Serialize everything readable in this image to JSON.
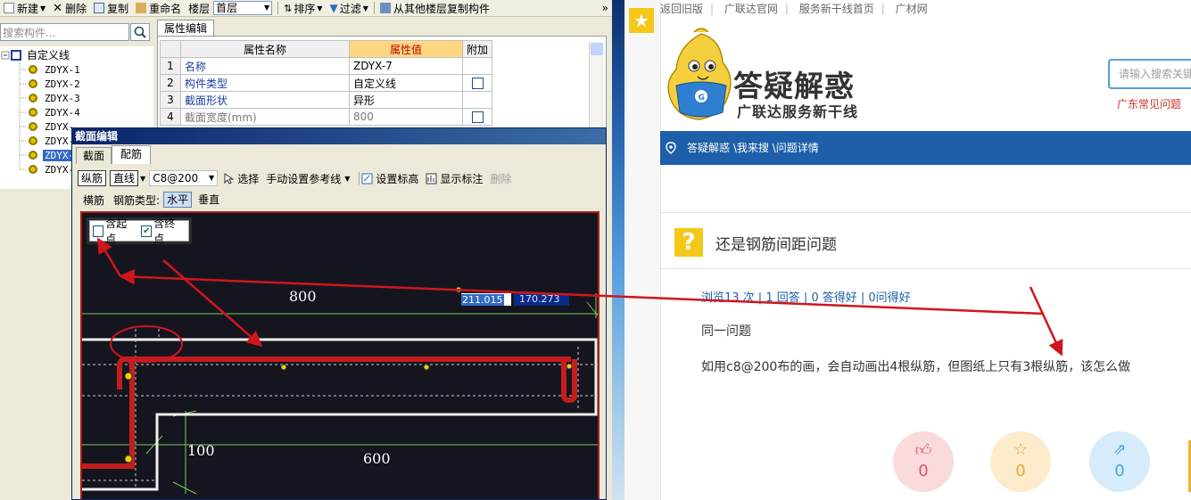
{
  "toolbar": {
    "new": "新建",
    "delete": "删除",
    "copy": "复制",
    "rename": "重命名",
    "floor_label": "楼层",
    "floor_value": "首层",
    "sort": "排序",
    "filter": "过滤",
    "copy_from_floor": "从其他楼层复制构件",
    "more": "»"
  },
  "search": {
    "placeholder": "搜索构件..."
  },
  "tree": {
    "root": "自定义线",
    "items": [
      "ZDYX-1",
      "ZDYX-2",
      "ZDYX-3",
      "ZDYX-4",
      "ZDYX-5",
      "ZDYX-6",
      "ZDYX-7",
      "ZDYX-8"
    ],
    "visible_items": [
      "ZDYX-1",
      "ZDYX-2",
      "ZDYX-3",
      "ZDYX-4",
      "ZDYX-",
      "ZDYX-",
      "ZDYX-",
      "ZDYX-"
    ]
  },
  "properties": {
    "tab": "属性编辑",
    "headers": {
      "name": "属性名称",
      "value": "属性值",
      "extra": "附加"
    },
    "rows": [
      {
        "num": "1",
        "name": "名称",
        "value": "ZDYX-7",
        "check": false
      },
      {
        "num": "2",
        "name": "构件类型",
        "value": "自定义线",
        "check": true
      },
      {
        "num": "3",
        "name": "截面形状",
        "value": "异形",
        "check": false
      },
      {
        "num": "4",
        "name": "截面宽度(mm)",
        "value": "800",
        "check": true
      }
    ]
  },
  "dialog": {
    "title": "截面编辑",
    "tabs": {
      "section": "截面",
      "rebar": "配筋"
    },
    "tb1": {
      "longitudinal": "纵筋",
      "straight": "直线",
      "spec": "C8@200",
      "select": "选择",
      "manual_ref": "手动设置参考线",
      "set_elevation": "设置标高",
      "show_dims": "显示标注",
      "delete": "删除"
    },
    "tb2": {
      "transverse": "横筋",
      "rebar_type": "钢筋类型:",
      "horizontal": "水平",
      "vertical": "垂直"
    },
    "canvas": {
      "include_start": "含起点",
      "include_end": "含终点",
      "include_start_checked": false,
      "include_end_checked": true,
      "dim_top": "800",
      "dim_left": "100",
      "dim_bottom": "600",
      "coord_x": "211.015",
      "coord_y": "170.273"
    }
  },
  "web": {
    "nav": [
      "返回旧版",
      "广联达官网",
      "服务新干线首页",
      "广材网"
    ],
    "brand_title": "答疑解惑",
    "brand_sub": "广联达服务新干线",
    "search_placeholder": "请输入搜索关键",
    "hot_link": "广东常见问题",
    "breadcrumb": "答疑解惑 \\我来搜 \\问题详情",
    "question_title": "还是钢筋间距问题",
    "stats": "浏览13 次 | 1 回答 | 0 答得好 | 0问得好",
    "line1": "同一问题",
    "line2": "如用c8@200布的画，会自动画出4根纵筋，但图纸上只有3根纵筋，该怎么做",
    "actions": {
      "like": "0",
      "favorite": "0",
      "share": "0"
    }
  },
  "colors": {
    "accent_blue": "#1d5fa8",
    "annotation_red": "#d0161d",
    "rebar_red": "#c41d1d",
    "brand_yellow": "#f5c71a"
  }
}
